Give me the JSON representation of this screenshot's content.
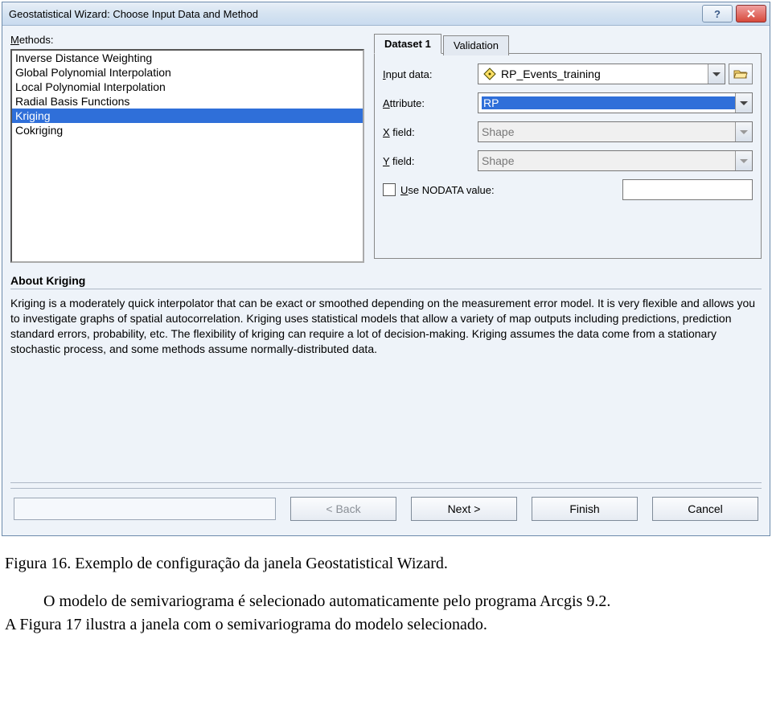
{
  "window": {
    "title": "Geostatistical Wizard: Choose Input Data and Method"
  },
  "methods": {
    "label": "Methods:",
    "items": [
      "Inverse Distance Weighting",
      "Global Polynomial Interpolation",
      "Local Polynomial Interpolation",
      "Radial Basis Functions",
      "Kriging",
      "Cokriging"
    ],
    "selected_index": 4
  },
  "tabs": {
    "dataset": "Dataset 1",
    "validation": "Validation"
  },
  "form": {
    "input_data_label": "Input data:",
    "input_data_label_u": "I",
    "input_data_value": "RP_Events_training",
    "attribute_label": "Attribute:",
    "attribute_label_u": "A",
    "attribute_value": "RP",
    "xfield_label": "X field:",
    "xfield_label_u": "X",
    "xfield_value": "Shape",
    "yfield_label": "Y field:",
    "yfield_label_u": "Y",
    "yfield_value": "Shape",
    "nodata_label": "Use NODATA value:",
    "nodata_label_u": "U"
  },
  "about": {
    "title": "About Kriging",
    "body": "Kriging is a moderately quick interpolator that can be exact or smoothed depending on the measurement error model. It is very flexible and allows you to investigate graphs of spatial autocorrelation. Kriging uses statistical models that allow a variety of map outputs including predictions, prediction standard errors, probability, etc. The flexibility of kriging can require a lot of decision-making. Kriging assumes the data come from a stationary stochastic process, and some methods assume normally-distributed data."
  },
  "buttons": {
    "back": "< Back",
    "next": "Next >",
    "finish": "Finish",
    "cancel": "Cancel"
  },
  "caption": {
    "line1": "Figura 16. Exemplo de configuração da janela Geostatistical Wizard.",
    "line2": "O modelo de semivariograma é selecionado automaticamente pelo programa Arcgis 9.2.",
    "line3": "A Figura 17 ilustra a janela com o semivariograma do modelo selecionado."
  }
}
